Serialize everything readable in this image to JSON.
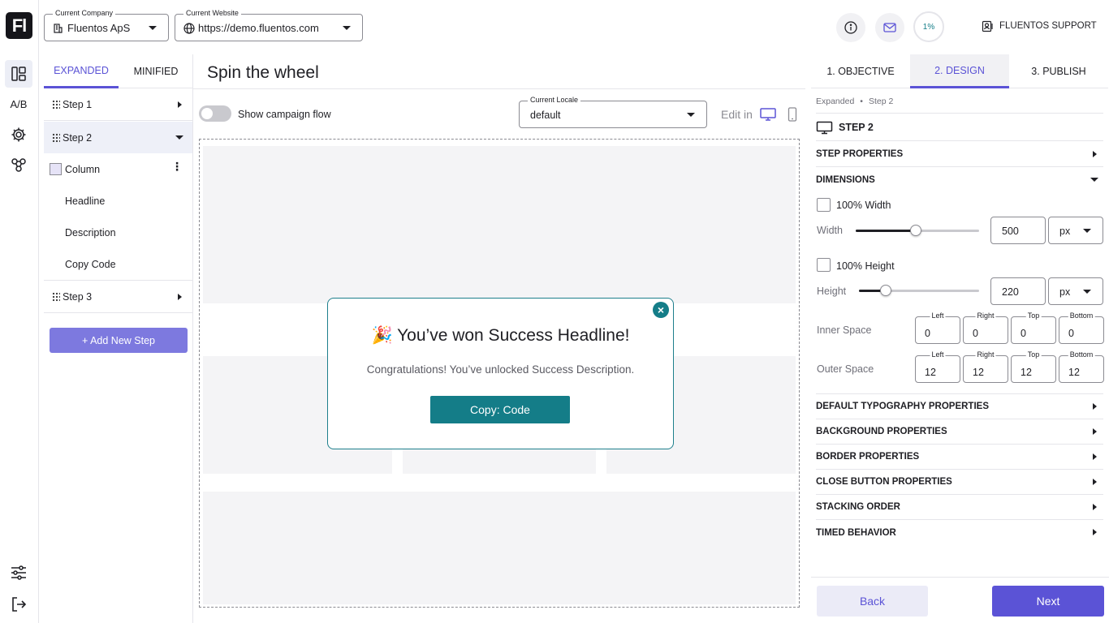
{
  "app": {
    "logo_text": "Fl"
  },
  "rail": {
    "ab_label": "A/B"
  },
  "topbar": {
    "company_label": "Current Company",
    "company_value": "Fluentos ApS",
    "website_label": "Current Website",
    "website_value": "https://demo.fluentos.com",
    "progress": "1%",
    "support_label": "FLUENTOS SUPPORT"
  },
  "left_panel": {
    "tabs": [
      {
        "label": "EXPANDED",
        "active": true
      },
      {
        "label": "MINIFIED",
        "active": false
      }
    ],
    "tree": {
      "step1": "Step 1",
      "step2": "Step 2",
      "column": "Column",
      "headline": "Headline",
      "description": "Description",
      "copy_code": "Copy Code",
      "step3": "Step 3"
    },
    "add_step_label": "+ Add New Step"
  },
  "main": {
    "title": "Spin the wheel",
    "toggle_label": "Show campaign flow",
    "locale_label": "Current Locale",
    "locale_value": "default",
    "edit_in_label": "Edit in",
    "popup": {
      "headline": "🎉 You’ve won Success Headline!",
      "description": "Congratulations! You’ve unlocked Success Description.",
      "button": "Copy: Code",
      "close": "×"
    }
  },
  "right_panel": {
    "tabs": [
      {
        "label": "1. OBJECTIVE",
        "active": false
      },
      {
        "label": "2. DESIGN",
        "active": true
      },
      {
        "label": "3. PUBLISH",
        "active": false
      }
    ],
    "breadcrumb": {
      "first": "Expanded",
      "separator": "•",
      "second": "Step 2"
    },
    "step_title": "STEP 2",
    "sections": {
      "step_properties": "STEP PROPERTIES",
      "dimensions": "DIMENSIONS",
      "typography": "DEFAULT TYPOGRAPHY PROPERTIES",
      "background": "BACKGROUND PROPERTIES",
      "border": "BORDER PROPERTIES",
      "close_button": "CLOSE BUTTON PROPERTIES",
      "stacking": "STACKING ORDER",
      "timed": "TIMED BEHAVIOR"
    },
    "dimensions": {
      "full_width_label": "100% Width",
      "width_label": "Width",
      "width_value": "500",
      "width_unit": "px",
      "width_slider_level": 0.49,
      "full_height_label": "100% Height",
      "height_label": "Height",
      "height_value": "220",
      "height_unit": "px",
      "height_slider_level": 0.22,
      "inner_space_label": "Inner Space",
      "outer_space_label": "Outer Space",
      "side_labels": {
        "left": "Left",
        "right": "Right",
        "top": "Top",
        "bottom": "Bottom"
      },
      "inner": {
        "left": "0",
        "right": "0",
        "top": "0",
        "bottom": "0"
      },
      "outer": {
        "left": "12",
        "right": "12",
        "top": "12",
        "bottom": "12"
      }
    },
    "back_label": "Back",
    "next_label": "Next"
  },
  "colors": {
    "accent": "#5b53d6",
    "accent_light": "#7d79df",
    "teal": "#147d88",
    "back_bg": "#ebebf7"
  }
}
